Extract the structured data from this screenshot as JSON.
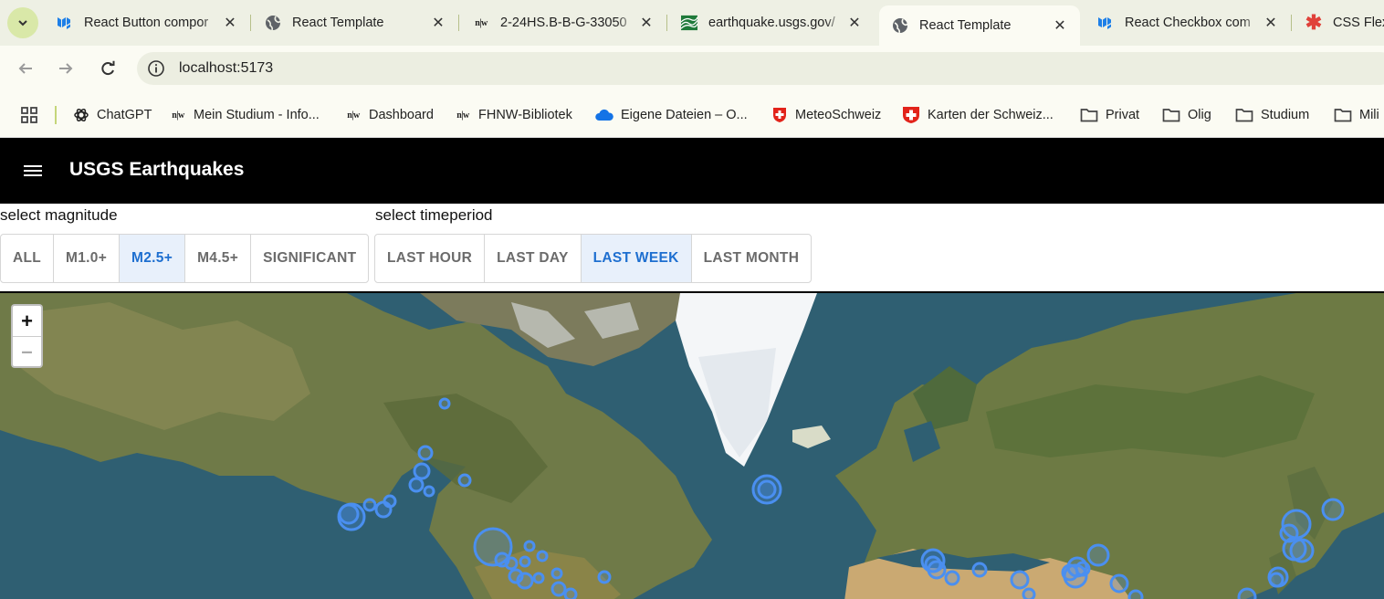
{
  "browser": {
    "tabs": [
      {
        "title": "React Button compor",
        "favicon": "mui-icon"
      },
      {
        "title": "React Template",
        "favicon": "globe-icon"
      },
      {
        "title": "2-24HS.B-B-G-33050",
        "favicon": "nw-icon"
      },
      {
        "title": "earthquake.usgs.gov/",
        "favicon": "usgs-icon"
      },
      {
        "title": "React Template",
        "favicon": "globe-icon",
        "active": true
      },
      {
        "title": "React Checkbox com",
        "favicon": "mui-icon"
      },
      {
        "title": "CSS Flexb",
        "favicon": "asterisk-icon"
      }
    ],
    "url": "localhost:5173",
    "bookmarks": [
      {
        "label": "ChatGPT",
        "icon": "chatgpt-icon"
      },
      {
        "label": "Mein Studium - Info...",
        "icon": "nw-icon"
      },
      {
        "label": "Dashboard",
        "icon": "nw-icon"
      },
      {
        "label": "FHNW-Bibliotek",
        "icon": "nw-icon"
      },
      {
        "label": "Eigene Dateien – O...",
        "icon": "cloud-icon"
      },
      {
        "label": "MeteoSchweiz",
        "icon": "swiss-shield-icon"
      },
      {
        "label": "Karten der Schweiz...",
        "icon": "swiss-shield-icon"
      },
      {
        "label": "Privat",
        "icon": "folder-icon"
      },
      {
        "label": "Olig",
        "icon": "folder-icon"
      },
      {
        "label": "Studium",
        "icon": "folder-icon"
      },
      {
        "label": "Mili",
        "icon": "folder-icon"
      }
    ]
  },
  "app": {
    "title": "USGS Earthquakes",
    "magnitude": {
      "label": "select magnitude",
      "options": [
        "ALL",
        "M1.0+",
        "M2.5+",
        "M4.5+",
        "SIGNIFICANT"
      ],
      "selected": "M2.5+"
    },
    "timeperiod": {
      "label": "select timeperiod",
      "options": [
        "LAST HOUR",
        "LAST DAY",
        "LAST WEEK",
        "LAST MONTH"
      ],
      "selected": "LAST WEEK"
    },
    "map": {
      "zoom_in": "+",
      "zoom_out": "–",
      "marker_color": "#4a8ff0"
    }
  },
  "colors": {
    "accent": "#1e6fd0",
    "selected_bg": "#e8f0fb",
    "appbar": "#000000"
  }
}
